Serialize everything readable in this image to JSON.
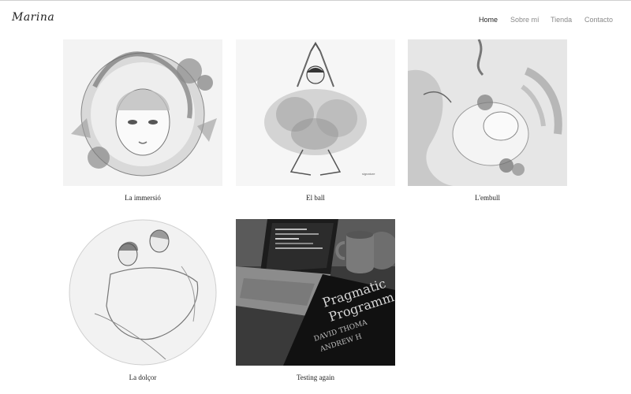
{
  "site": {
    "logo": "Marina"
  },
  "nav": {
    "items": [
      {
        "label": "Home",
        "active": true
      },
      {
        "label": "Sobre mí",
        "active": false
      },
      {
        "label": "Tienda",
        "active": false
      },
      {
        "label": "Contacto",
        "active": false
      }
    ]
  },
  "gallery": {
    "items": [
      {
        "title": "La immersió"
      },
      {
        "title": "El ball"
      },
      {
        "title": "L'embull"
      },
      {
        "title": "La dolçor"
      },
      {
        "title": "Testing again"
      }
    ]
  }
}
